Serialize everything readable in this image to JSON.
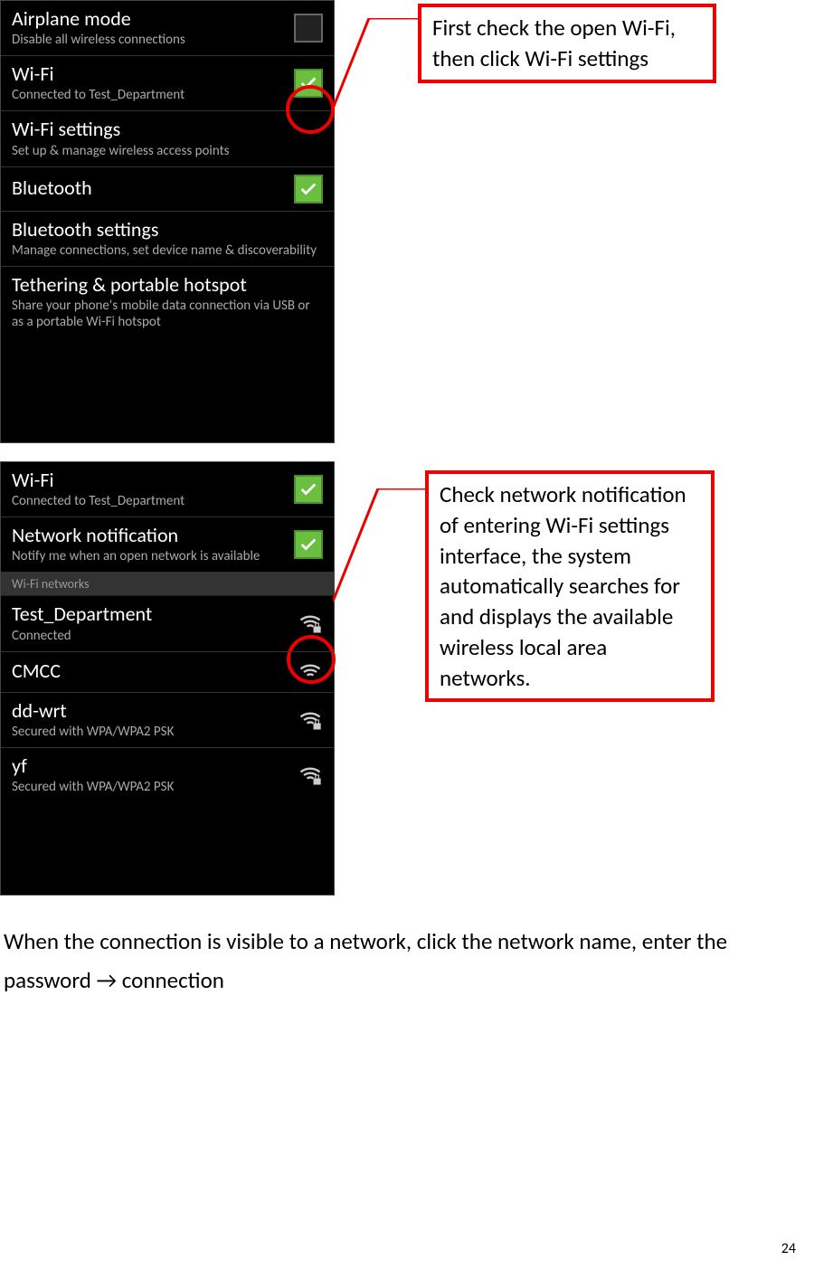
{
  "callouts": {
    "c1": "First check the open Wi-Fi, then click Wi-Fi settings",
    "c2": "Check network notification of entering Wi-Fi settings interface, the system automatically searches for and displays the available wireless local area networks."
  },
  "phone1": {
    "rows": [
      {
        "title": "Airplane mode",
        "sub": "Disable all wireless connections",
        "check": false
      },
      {
        "title": "Wi-Fi",
        "sub": "Connected to Test_Department",
        "check": true
      },
      {
        "title": "Wi-Fi settings",
        "sub": "Set up & manage wireless access points"
      },
      {
        "title": "Bluetooth",
        "sub": "",
        "check": true
      },
      {
        "title": "Bluetooth settings",
        "sub": "Manage connections, set device name & discoverability"
      },
      {
        "title": "Tethering & portable hotspot",
        "sub": "Share your phone's mobile data connection via USB or as a portable Wi-Fi hotspot"
      }
    ]
  },
  "phone2": {
    "top": [
      {
        "title": "Wi-Fi",
        "sub": "Connected to Test_Department",
        "check": true
      },
      {
        "title": "Network notification",
        "sub": "Notify me when an open network is available",
        "check": true
      }
    ],
    "header": "Wi-Fi networks",
    "nets": [
      {
        "title": "Test_Department",
        "sub": "Connected",
        "lock": true
      },
      {
        "title": "CMCC",
        "sub": "",
        "lock": false
      },
      {
        "title": "dd-wrt",
        "sub": "Secured with WPA/WPA2 PSK",
        "lock": true
      },
      {
        "title": "yf",
        "sub": "Secured with WPA/WPA2 PSK",
        "lock": true
      }
    ]
  },
  "body": "When the connection is visible to a network, click the network name, enter the password → connection",
  "page": "24"
}
